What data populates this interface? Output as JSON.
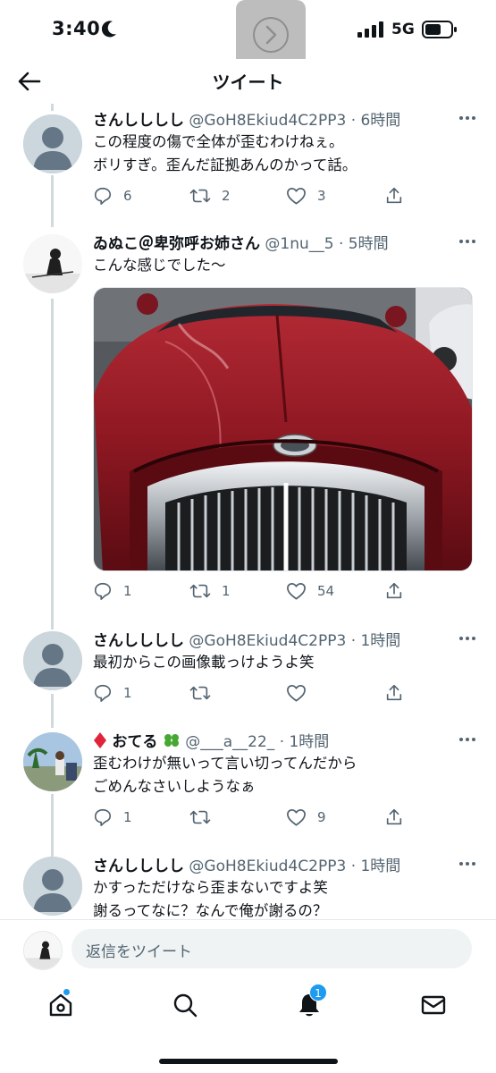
{
  "status_bar": {
    "time": "3:40",
    "network": "5G"
  },
  "header": {
    "title": "ツイート"
  },
  "tweets": [
    {
      "name": "さんしししし",
      "handle": "@GoH8Ekiud4C2PP3",
      "time": "· 6時間",
      "text": "この程度の傷で全体が歪むわけねぇ。\nボリすぎ。歪んだ証拠あんのかって話。",
      "replies": "6",
      "retweets": "2",
      "likes": "3"
    },
    {
      "name": "ゐぬこ＠卑弥呼お姉さん",
      "handle": "@1nu__5",
      "time": "· 5時間",
      "text": "こんな感じでした〜",
      "replies": "1",
      "retweets": "1",
      "likes": "54"
    },
    {
      "name": "さんしししし",
      "handle": "@GoH8Ekiud4C2PP3",
      "time": "· 1時間",
      "text": "最初からこの画像載っけようよ笑",
      "replies": "1",
      "retweets": "",
      "likes": ""
    },
    {
      "name": "おてる",
      "handle": "@___a__22_",
      "time": "· 1時間",
      "text": "歪むわけが無いって言い切ってんだから\nごめんなさいしようなぁ",
      "replies": "1",
      "retweets": "",
      "likes": "9"
    },
    {
      "name": "さんしししし",
      "handle": "@GoH8Ekiud4C2PP3",
      "time": "· 1時間",
      "text": "かすっただけなら歪まないですよ笑\n謝るってなに？なんで俺が謝るの？",
      "replies": "",
      "retweets": "",
      "likes": ""
    }
  ],
  "reply_bar": {
    "placeholder": "返信をツイート"
  },
  "tab_bar": {
    "notifications_badge": "1"
  },
  "colors": {
    "accent": "#1d9bf0",
    "secondary_text": "#536471",
    "primary_text": "#0f1419"
  },
  "icons": [
    "back-arrow-icon",
    "forward-icon",
    "more-icon",
    "reply-icon",
    "retweet-icon",
    "like-icon",
    "share-icon",
    "home-icon",
    "search-icon",
    "bell-icon",
    "mail-icon",
    "diamond-icon",
    "clover-icon"
  ]
}
